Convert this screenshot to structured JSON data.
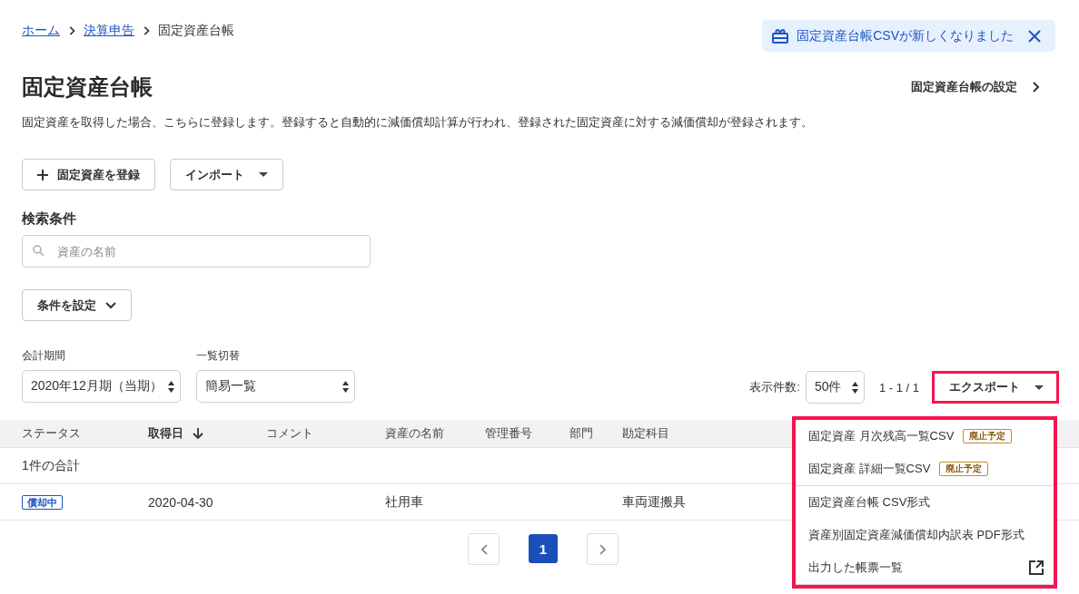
{
  "breadcrumb": [
    {
      "label": "ホーム",
      "link": true
    },
    {
      "label": "決算申告",
      "link": true
    },
    {
      "label": "固定資産台帳",
      "link": false
    }
  ],
  "notice": {
    "text": "固定資産台帳CSVが新しくなりました"
  },
  "title": "固定資産台帳",
  "settings_link": "固定資産台帳の設定",
  "description": "固定資産を取得した場合、こちらに登録します。登録すると自動的に減価償却計算が行われ、登録された固定資産に対する減価償却が登録されます。",
  "actions": [
    {
      "label": "固定資産を登録",
      "kind": "add"
    },
    {
      "label": "インポート",
      "kind": "dropdown"
    }
  ],
  "search": {
    "heading": "検索条件",
    "placeholder": "資産の名前",
    "conditions_button": "条件を設定"
  },
  "filters": [
    {
      "label": "会計期間",
      "value": "2020年12月期（当期）"
    },
    {
      "label": "一覧切替",
      "value": "簡易一覧"
    }
  ],
  "page_size": {
    "label": "表示件数:",
    "value": "50件"
  },
  "range": "1 - 1 / 1",
  "export_button": {
    "label": "エクスポート",
    "highlighted": true
  },
  "table": {
    "columns": [
      {
        "label": "ステータス",
        "sorted": false
      },
      {
        "label": "取得日",
        "sorted": true
      },
      {
        "label": "コメント",
        "sorted": false
      },
      {
        "label": "資産の名前",
        "sorted": false
      },
      {
        "label": "管理番号",
        "sorted": false
      },
      {
        "label": "部門",
        "sorted": false
      },
      {
        "label": "勘定科目",
        "sorted": false
      }
    ],
    "rows": [
      {
        "kind": "total",
        "label": "1件の合計"
      },
      {
        "kind": "asset",
        "status": "償却中",
        "acquired": "2020-04-30",
        "asset_name": "社用車",
        "account": "車両運搬具"
      }
    ]
  },
  "pagination": {
    "pages": [
      {
        "label": "1",
        "selected": true
      }
    ]
  },
  "export_menu": {
    "highlighted": true,
    "items": [
      {
        "label": "固定資産 月次残高一覧CSV",
        "badge": "廃止予定",
        "separator_above": false,
        "external": false
      },
      {
        "label": "固定資産 詳細一覧CSV",
        "badge": "廃止予定",
        "separator_above": false,
        "external": false
      },
      {
        "label": "固定資産台帳 CSV形式",
        "separator_above": true,
        "external": false
      },
      {
        "label": "資産別固定資産減価償却内訳表 PDF形式",
        "separator_above": false,
        "external": false
      },
      {
        "label": "出力した帳票一覧",
        "separator_above": false,
        "external": true
      }
    ]
  }
}
